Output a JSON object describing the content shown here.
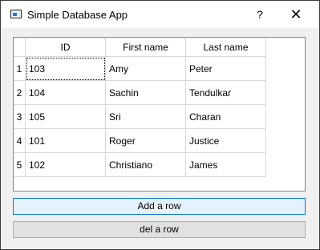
{
  "window": {
    "title": "Simple Database App",
    "help_label": "?",
    "close_label": "✕"
  },
  "table": {
    "columns": [
      "ID",
      "First name",
      "Last name"
    ],
    "row_numbers": [
      "1",
      "2",
      "3",
      "4",
      "5"
    ],
    "rows": [
      [
        "103",
        "Amy",
        "Peter"
      ],
      [
        "104",
        "Sachin",
        "Tendulkar"
      ],
      [
        "105",
        "Sri",
        "Charan"
      ],
      [
        "101",
        "Roger",
        "Justice"
      ],
      [
        "102",
        "Christiano",
        "James"
      ]
    ]
  },
  "buttons": {
    "add_label": "Add a row",
    "del_label": "del a row"
  }
}
